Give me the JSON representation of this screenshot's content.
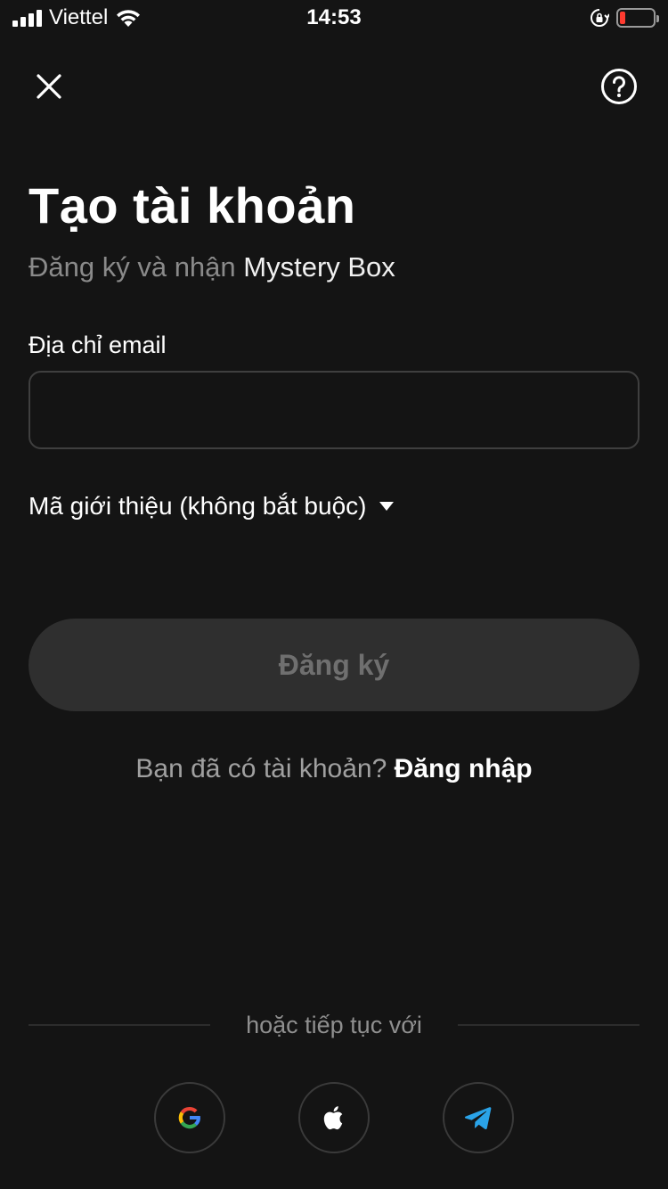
{
  "status_bar": {
    "carrier": "Viettel",
    "time": "14:53"
  },
  "header": {
    "close_icon": "close-icon",
    "help_icon": "help-circle-icon"
  },
  "title": "Tạo tài khoản",
  "subtitle": {
    "prefix": "Đăng ký và nhận ",
    "highlight": "Mystery Box"
  },
  "email": {
    "label": "Địa chỉ email",
    "value": "",
    "placeholder": ""
  },
  "referral": {
    "label": "Mã giới thiệu (không bắt buộc)",
    "icon": "caret-down-icon"
  },
  "register_button": {
    "label": "Đăng ký"
  },
  "login_prompt": {
    "question": "Bạn đã có tài khoản? ",
    "link": "Đăng nhập"
  },
  "divider": {
    "text": "hoặc tiếp tục với"
  },
  "social": [
    {
      "name": "google",
      "icon": "google-icon"
    },
    {
      "name": "apple",
      "icon": "apple-icon"
    },
    {
      "name": "telegram",
      "icon": "telegram-icon"
    }
  ],
  "colors": {
    "background": "#141414",
    "button_disabled": "#2f2f2f",
    "battery_low": "#ff3b30",
    "telegram_blue": "#2aa3e8"
  }
}
